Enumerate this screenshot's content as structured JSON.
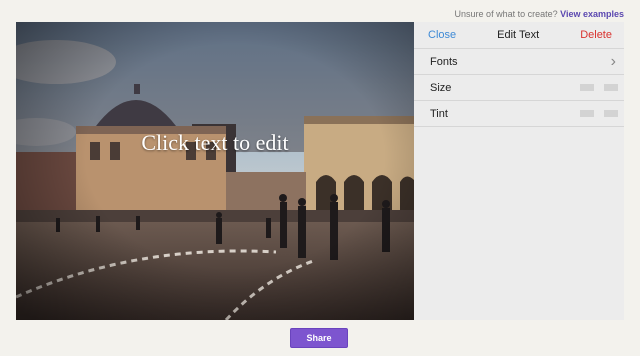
{
  "header": {
    "prompt_text": "Unsure of what to create?",
    "examples_link": "View examples"
  },
  "canvas": {
    "overlay_text": "Click text to edit"
  },
  "panel": {
    "close_label": "Close",
    "title": "Edit Text",
    "delete_label": "Delete",
    "rows": [
      {
        "label": "Fonts",
        "control": "chevron-right-icon"
      },
      {
        "label": "Size",
        "control": "size-swatches"
      },
      {
        "label": "Tint",
        "control": "tint-swatches"
      }
    ]
  },
  "footer": {
    "share_label": "Share"
  },
  "colors": {
    "accent": "#7d55cf",
    "link": "#5b48b0",
    "close": "#3e8ad6",
    "delete": "#d9322e"
  }
}
